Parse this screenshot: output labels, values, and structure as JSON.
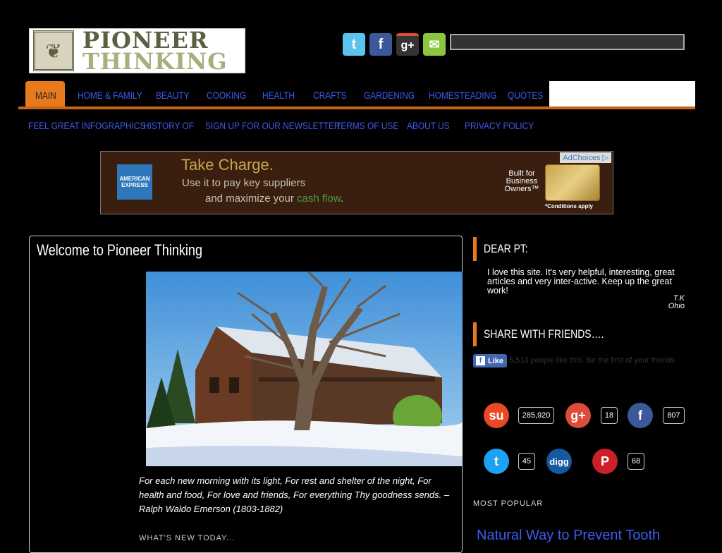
{
  "logo": {
    "line1": "PIONEER",
    "line2": "THINKING"
  },
  "social_top": [
    "twitter-icon",
    "facebook-icon",
    "google-plus-icon",
    "email-icon"
  ],
  "search": {
    "value": ""
  },
  "nav": {
    "row1": [
      "MAIN",
      "HOME & FAMILY",
      "BEAUTY",
      "COOKING",
      "HEALTH",
      "CRAFTS",
      "GARDENING",
      "HOMESTEADING",
      "QUOTES"
    ],
    "row2": [
      "FEEL GREAT INFOGRAPHICS",
      "HISTORY OF",
      "SIGN UP FOR OUR NEWSLETTER",
      "TERMS OF USE",
      "ABOUT US",
      "PRIVACY POLICY"
    ]
  },
  "ad": {
    "adchoices": "AdChoices",
    "brand_line1": "AMERICAN",
    "brand_line2": "EXPRESS",
    "headline": "Take Charge.",
    "line1": "Use it to pay key suppliers",
    "line2_pre": "and maximize your ",
    "line2_highlight": "cash flow",
    "line2_post": ".",
    "built_for": "Built for",
    "business": "Business",
    "owners": "Owners™",
    "conditions": "*Conditions apply"
  },
  "main": {
    "title": "Welcome to Pioneer Thinking",
    "quote": "For each new morning with its light, For rest and shelter of the night, For health and food, For love and friends, For everything  Thy goodness sends. – Ralph Waldo Emerson (1803-1882)",
    "whats_new": "WHAT'S NEW TODAY..."
  },
  "sidebar": {
    "dear_pt_title": "DEAR PT:",
    "testimonial": "I love this site. It's very helpful, interesting, great articles and very inter-active. Keep up the great work!",
    "author": "T.K",
    "location": "Ohio",
    "share_title": "SHARE WITH FRIENDS….",
    "fb_like": "Like",
    "fb_text": "5,513 people like this. Be the first of your friends.",
    "shares": [
      {
        "icon": "stumbleupon-icon",
        "count": "285,920",
        "color": "#eb4924"
      },
      {
        "icon": "google-plus-icon",
        "count": "18",
        "color": "#dd4b39"
      },
      {
        "icon": "facebook-icon",
        "count": "807",
        "color": "#3b5998"
      },
      {
        "icon": "twitter-icon",
        "count": "45",
        "color": "#1da1f2"
      },
      {
        "icon": "digg-icon",
        "count": "",
        "color": "#14589e"
      },
      {
        "icon": "pinterest-icon",
        "count": "68",
        "color": "#cb2027"
      }
    ],
    "most_popular": "MOST POPULAR",
    "popular_link": "Natural Way to Prevent Tooth"
  }
}
